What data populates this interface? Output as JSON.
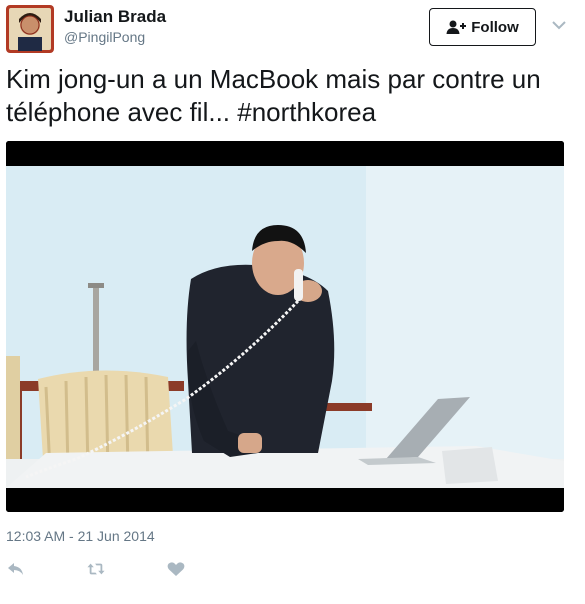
{
  "author": {
    "name": "Julian Brada",
    "handle": "@PingilPong"
  },
  "follow_button": {
    "label": "Follow"
  },
  "tweet": {
    "text": "Kim jong-un a un MacBook mais par contre un téléphone avec fil... ",
    "hashtag": "#northkorea"
  },
  "timestamp": "12:03 AM - 21 Jun 2014",
  "icons": {
    "avatar": "avatar-image",
    "follow": "add-user-icon",
    "menu": "chevron-down-icon",
    "reply": "reply-icon",
    "retweet": "retweet-icon",
    "like": "heart-icon"
  },
  "colors": {
    "text": "#14171a",
    "muted": "#657786",
    "icon": "#aab8c2"
  }
}
